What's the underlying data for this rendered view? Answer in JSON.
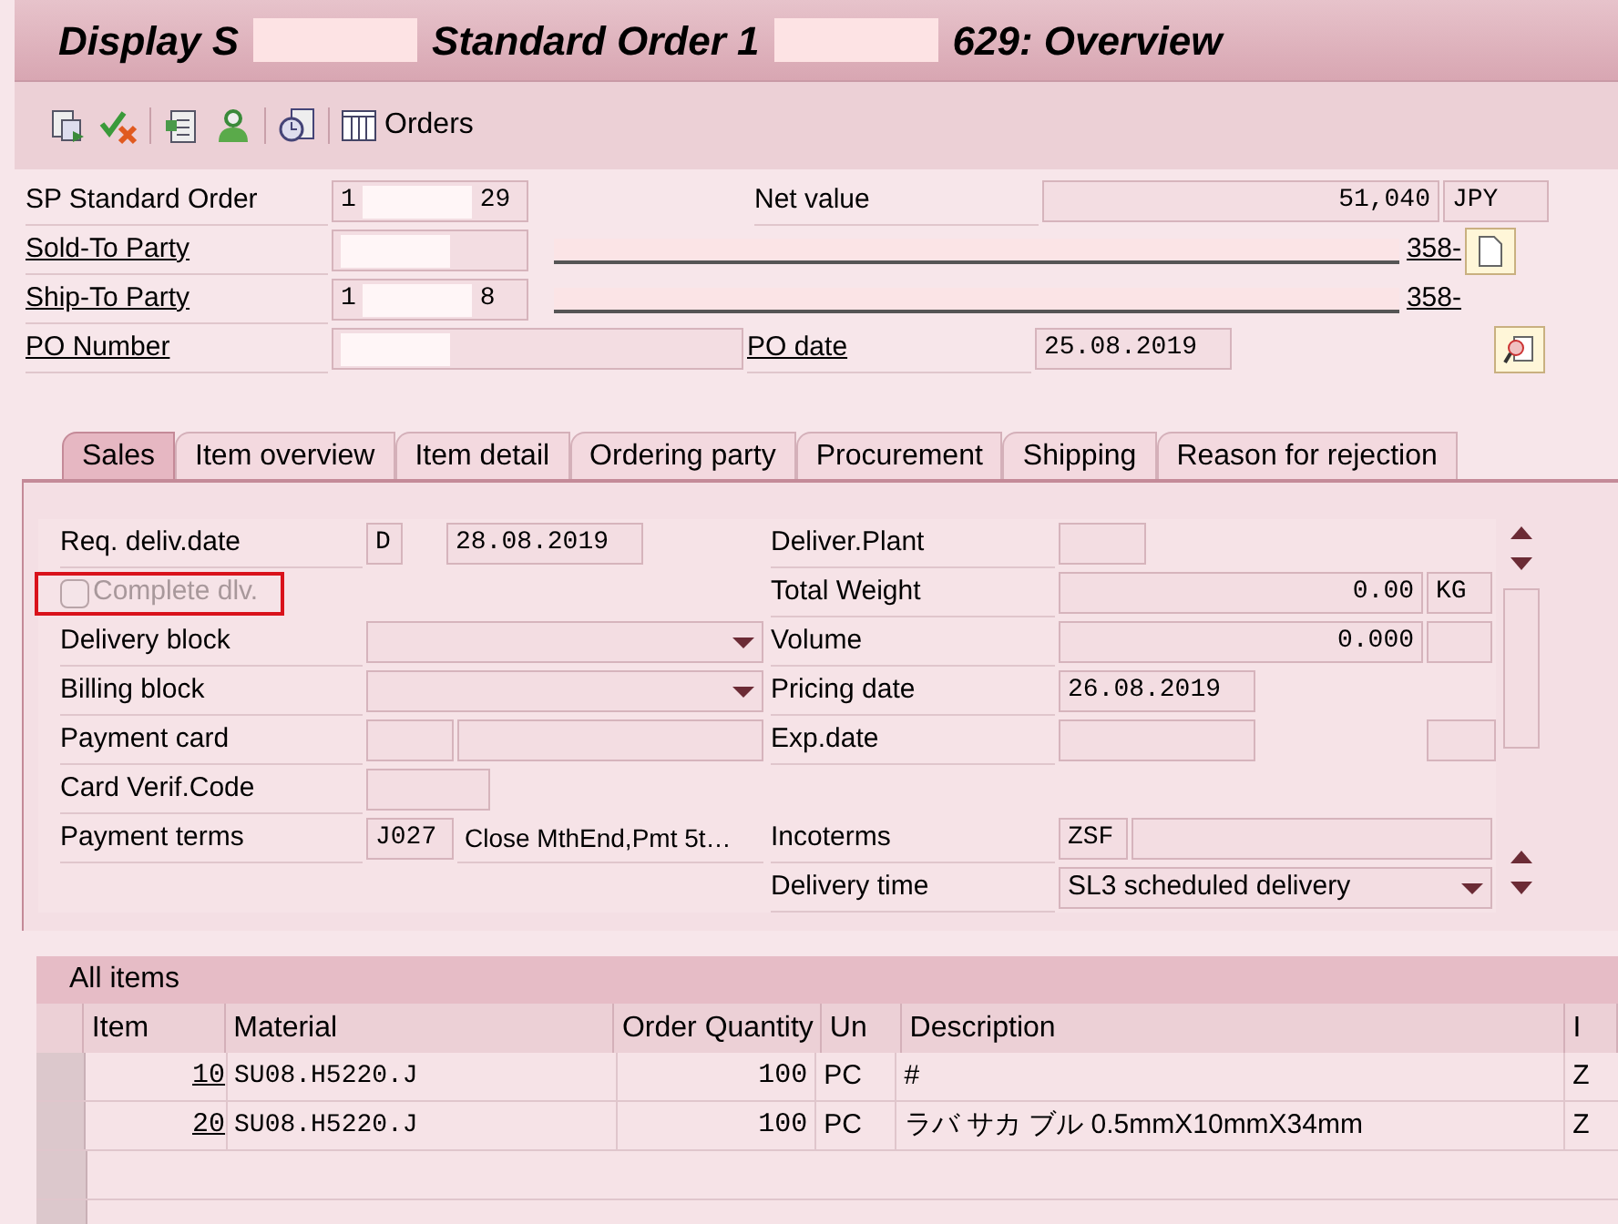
{
  "title": [
    {
      "kind": "text",
      "text": "Display S"
    },
    {
      "kind": "redacted"
    },
    {
      "kind": "text",
      "text": "Standard Order 1"
    },
    {
      "kind": "redacted"
    },
    {
      "kind": "text",
      "text": "629: Overview"
    }
  ],
  "toolbar": {
    "label": "Orders"
  },
  "header": {
    "order": {
      "label": "SP Standard Order",
      "link": false,
      "value_parts": [
        {
          "kind": "text",
          "text": "1"
        },
        {
          "kind": "redacted"
        },
        {
          "kind": "text",
          "text": "29"
        }
      ]
    },
    "net_value": {
      "label": "Net value",
      "value": "51,040",
      "currency": "JPY"
    },
    "sold_to": {
      "label": "Sold-To Party",
      "link": true,
      "value_parts": [
        {
          "kind": "redacted"
        }
      ],
      "description": "358-"
    },
    "ship_to": {
      "label": "Ship-To Party",
      "link": true,
      "value_parts": [
        {
          "kind": "text",
          "text": "1"
        },
        {
          "kind": "redacted"
        },
        {
          "kind": "text",
          "text": "8"
        }
      ],
      "description": "358-"
    },
    "po_number": {
      "label": "PO Number",
      "link": true,
      "value_parts": [
        {
          "kind": "redacted"
        }
      ]
    },
    "po_date": {
      "label": "PO date",
      "link": true,
      "value": "25.08.2019"
    }
  },
  "tabs": [
    {
      "label": "Sales",
      "selected": true
    },
    {
      "label": "Item overview",
      "selected": false
    },
    {
      "label": "Item detail",
      "selected": false
    },
    {
      "label": "Ordering party",
      "selected": false
    },
    {
      "label": "Procurement",
      "selected": false
    },
    {
      "label": "Shipping",
      "selected": false
    },
    {
      "label": "Reason for rejection",
      "selected": false
    }
  ],
  "sales_left": [
    {
      "kind": "date",
      "label": "Req. deliv.date",
      "code": "D",
      "value": "28.08.2019"
    },
    {
      "kind": "checkbox",
      "label": "Complete dlv.",
      "checked": false,
      "disabled": true,
      "highlighted": true
    },
    {
      "kind": "dropdown",
      "label": "Delivery block"
    },
    {
      "kind": "dropdown",
      "label": "Billing block"
    },
    {
      "kind": "pair",
      "label": "Payment card"
    },
    {
      "kind": "short",
      "label": "Card Verif.Code"
    },
    {
      "kind": "code_text",
      "label": "Payment terms",
      "code": "J027",
      "text": "Close MthEnd,Pmt 5t…"
    }
  ],
  "sales_right": [
    {
      "kind": "short",
      "label": "Deliver.Plant"
    },
    {
      "kind": "unit",
      "label": "Total Weight",
      "value": "0.00",
      "unit": "KG"
    },
    {
      "kind": "unit",
      "label": "Volume",
      "value": "0.000"
    },
    {
      "kind": "date",
      "label": "Pricing date",
      "value": "26.08.2019"
    },
    {
      "kind": "date_extra",
      "label": "Exp.date"
    },
    {
      "kind": "spacer"
    },
    {
      "kind": "code_field",
      "label": "Incoterms",
      "code": "ZSF"
    },
    {
      "kind": "dropdown",
      "label": "Delivery time",
      "value": "SL3 scheduled delivery"
    }
  ],
  "items": {
    "title": "All items",
    "columns": [
      "Item",
      "Material",
      "Order Quantity",
      "Un",
      "Description",
      "I"
    ],
    "rows": [
      {
        "item": "10",
        "material": "SU08.H5220.J",
        "quantity": "100",
        "unit": "PC",
        "description": "#",
        "last": "Z"
      },
      {
        "item": "20",
        "material": "SU08.H5220.J",
        "quantity": "100",
        "unit": "PC",
        "description": "ラバ サカ ブル 0.5mmX10mmX34mm",
        "last": "Z"
      }
    ]
  }
}
